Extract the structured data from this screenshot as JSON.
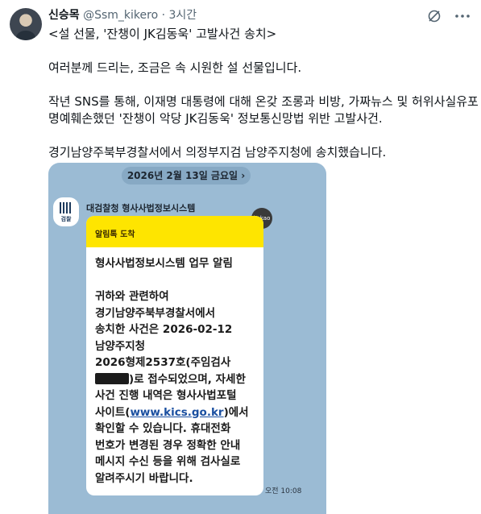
{
  "post": {
    "author_name": "신승목",
    "handle": "@Ssm_kikero",
    "separator": "·",
    "time": "3시간",
    "lines": [
      "<설 선물, '잔챙이 JK김동욱' 고발사건 송치>",
      "",
      "여러분께 드리는, 조금은 속 시원한 설 선물입니다.",
      "",
      "작년 SNS를 통해, 이재명 대통령에 대해 온갖 조롱과 비방, 가짜뉴스 및 허위사실유포",
      "명예훼손했던 '잔챙이 악당 JK김동욱' 정보통신망법 위반 고발사건.",
      "",
      "경기남양주북부경찰서에서 의정부지검 남양주지청에 송치했습니다."
    ]
  },
  "image": {
    "date_pill": "2026년 2월 13일 금요일",
    "date_chevron": "›",
    "channel_name": "대검찰청 형사사법정보시스템",
    "channel_logo_text": "검찰",
    "kakao_badge": "kakao",
    "bubble_header": "알림톡 도착",
    "message_lines": [
      "형사사법정보시스템 업무 알림",
      "",
      "귀하와 관련하여",
      "경기남양주북부경찰서에서",
      "송치한 사건은 2026-02-12",
      "남양주지청",
      "2026형제2537호(주임검사"
    ],
    "redacted_suffix": ")로 접수되었으며, 자세한",
    "message_lines_2": [
      "사건 진행 내역은 형사사법포털",
      "사이트("
    ],
    "link": "www.kics.go.kr",
    "after_link": ")에서",
    "message_lines_3": [
      "확인할 수 있습니다. 휴대전화",
      "번호가 변경된 경우 정확한 안내",
      "메시지 수신 등을 위해 검사실로",
      "알려주시기 바랍니다."
    ],
    "timestamp": "오전 10:08"
  },
  "colors": {
    "chat_background": "#9bbbd4",
    "kakao_yellow": "#fee500",
    "text_secondary": "#536471"
  }
}
